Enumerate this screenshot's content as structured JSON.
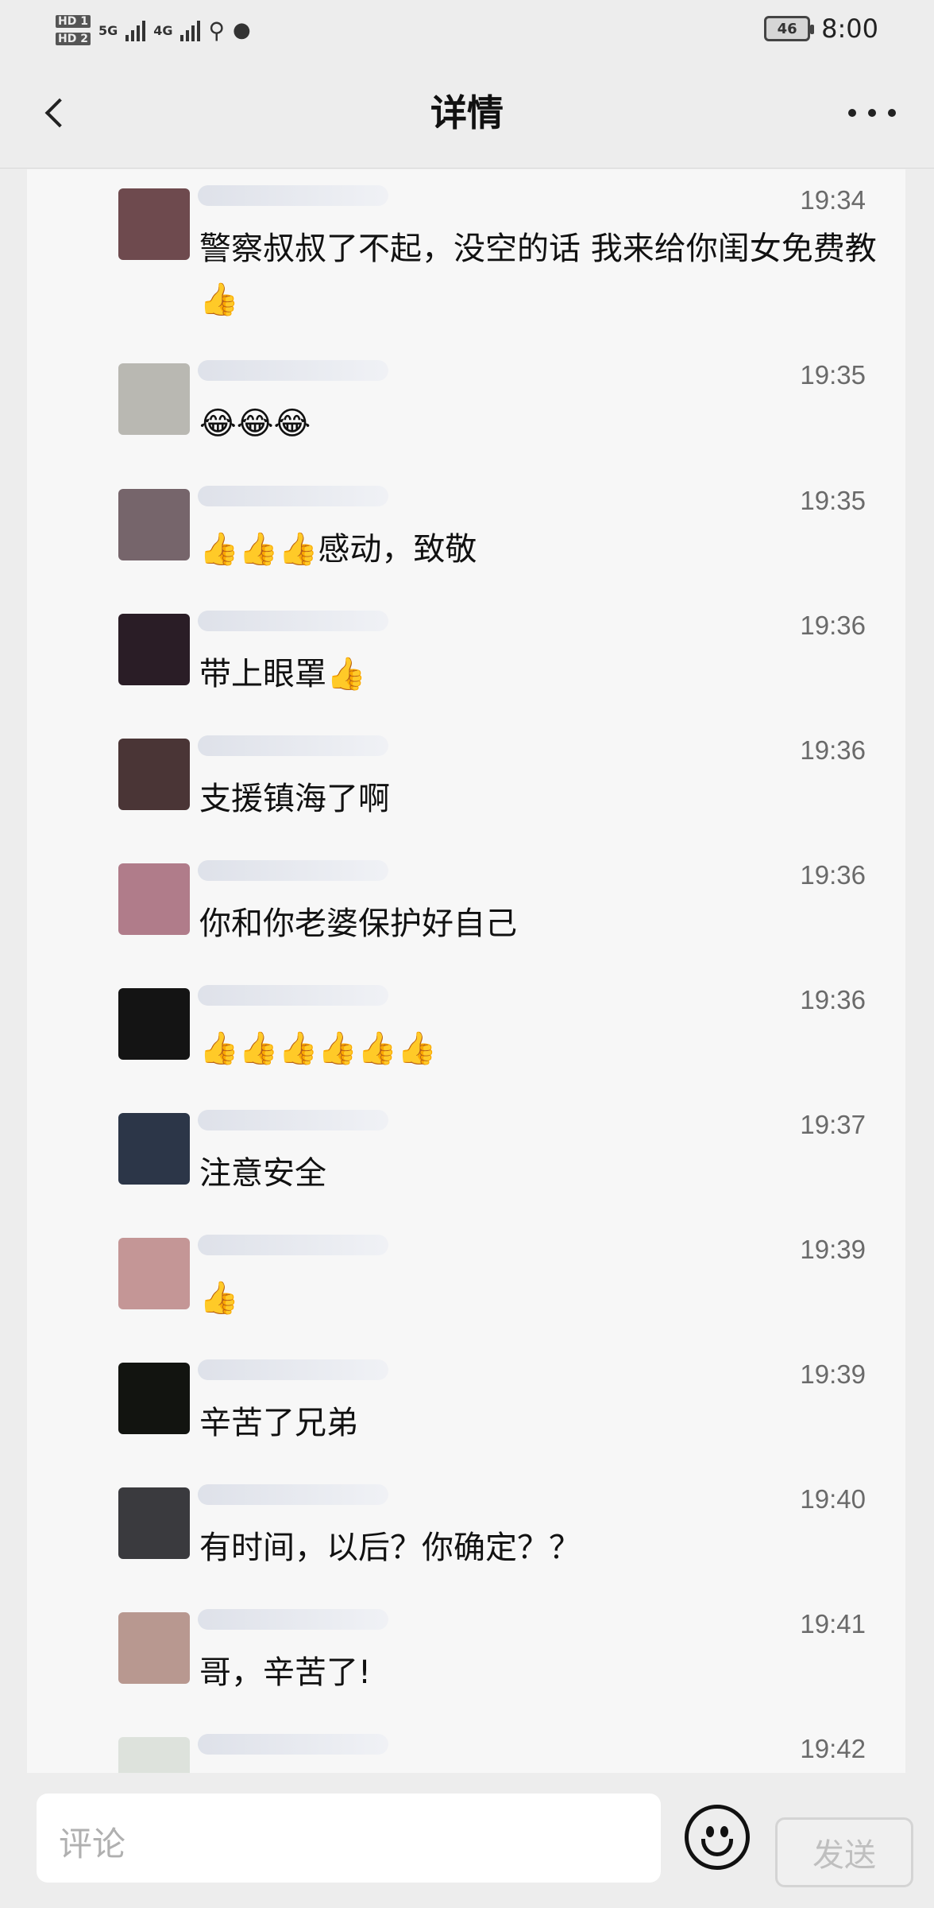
{
  "status_bar": {
    "sim1": "HD 1",
    "sim2": "HD 2",
    "net1": "5G",
    "net2": "4G",
    "battery": "46",
    "time": "8:00"
  },
  "nav": {
    "title": "详情",
    "back_icon": "chevron-left-icon",
    "more_icon": "more-horizontal-icon"
  },
  "comments": [
    {
      "time": "19:34",
      "text": "警察叔叔了不起，没空的话 我来给你闺女免费教👍",
      "avatar_color": "#6e4a4e"
    },
    {
      "time": "19:35",
      "text": "😂😂😂",
      "avatar_color": "#b9b8b2"
    },
    {
      "time": "19:35",
      "text": "👍👍👍感动，致敬",
      "avatar_color": "#76656b"
    },
    {
      "time": "19:36",
      "text": "带上眼罩👍",
      "avatar_color": "#2a1d26"
    },
    {
      "time": "19:36",
      "text": "支援镇海了啊",
      "avatar_color": "#4a3536"
    },
    {
      "time": "19:36",
      "text": "你和你老婆保护好自己",
      "avatar_color": "#b07c8a"
    },
    {
      "time": "19:36",
      "text": "👍👍👍👍👍👍",
      "avatar_color": "#141414"
    },
    {
      "time": "19:37",
      "text": "注意安全",
      "avatar_color": "#2c3648"
    },
    {
      "time": "19:39",
      "text": "👍",
      "avatar_color": "#c49696"
    },
    {
      "time": "19:39",
      "text": "辛苦了兄弟",
      "avatar_color": "#121410"
    },
    {
      "time": "19:40",
      "text": "有时间，以后？你确定？？",
      "avatar_color": "#3a3a3e"
    },
    {
      "time": "19:41",
      "text": "哥，辛苦了!",
      "avatar_color": "#b89890"
    },
    {
      "time": "19:42",
      "text": "",
      "avatar_color": "#dde2dc"
    }
  ],
  "bottom_bar": {
    "comment_placeholder": "评论",
    "emoji_icon": "smiley-icon",
    "send_label": "发送"
  }
}
